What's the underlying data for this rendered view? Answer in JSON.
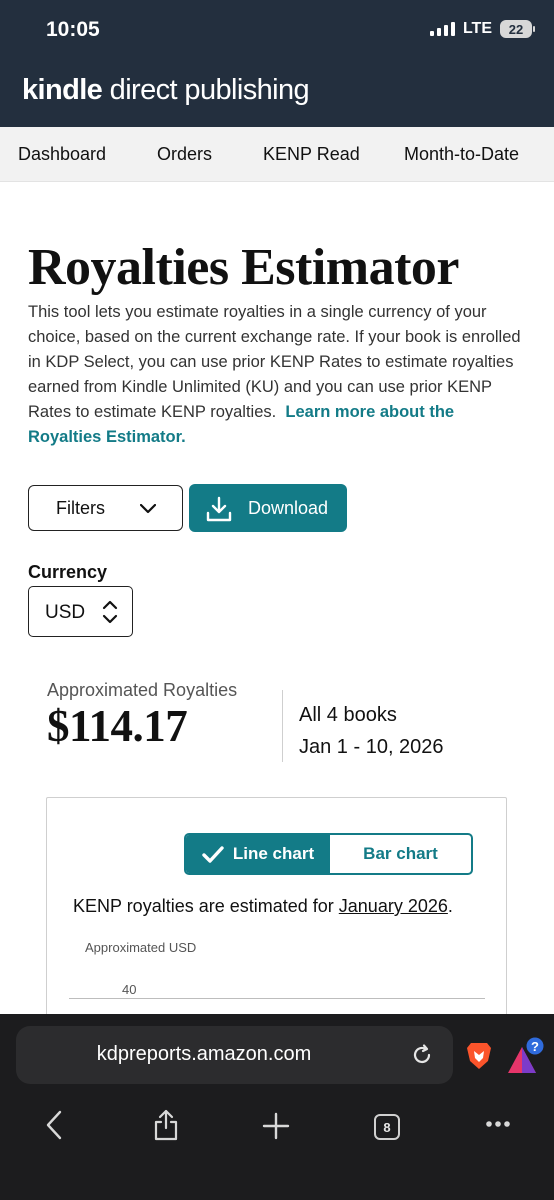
{
  "status_bar": {
    "time": "10:05",
    "network": "LTE",
    "battery": "22"
  },
  "header": {
    "brand_bold": "kindle",
    "brand_rest": " direct publishing"
  },
  "nav": {
    "items": [
      "Dashboard",
      "Orders",
      "KENP Read",
      "Month-to-Date"
    ]
  },
  "page": {
    "title": "Royalties Estimator",
    "description": "This tool lets you estimate royalties in a single currency of your choice, based on the current exchange rate. If your book is enrolled in KDP Select, you can use prior KENP Rates to estimate royalties earned from Kindle Unlimited (KU) and you can use prior KENP Rates to estimate KENP royalties.",
    "learn_more": "Learn more about the Royalties Estimator."
  },
  "actions": {
    "filters_label": "Filters",
    "download_label": "Download"
  },
  "currency": {
    "label": "Currency",
    "value": "USD"
  },
  "summary": {
    "approx_label": "Approximated Royalties",
    "amount": "$114.17",
    "books": "All 4 books",
    "date_range": "Jan 1 - 10, 2026"
  },
  "chart_card": {
    "toggle": {
      "line_label": "Line chart",
      "bar_label": "Bar chart",
      "selected": "Line chart"
    },
    "note_prefix": "KENP royalties are estimated for ",
    "note_month": "January 2026",
    "note_suffix": ".",
    "y_axis_title": "Approximated USD",
    "tick_label": "40"
  },
  "chart_data": {
    "type": "line",
    "ylabel": "Approximated USD",
    "yticks": [
      40
    ],
    "series": []
  },
  "browser": {
    "url": "kdpreports.amazon.com",
    "tab_count": "8",
    "rewards_badge": "?"
  },
  "colors": {
    "accent": "#137b87",
    "header": "#232f3e",
    "browser": "#1c1c1e"
  },
  "icons": [
    "chevron-down-icon",
    "download-icon",
    "stepper-icon",
    "checkmark-icon",
    "reload-icon",
    "brave-lion-icon",
    "brave-rewards-icon",
    "back-icon",
    "share-icon",
    "new-tab-icon",
    "tabs-icon",
    "more-icon"
  ]
}
